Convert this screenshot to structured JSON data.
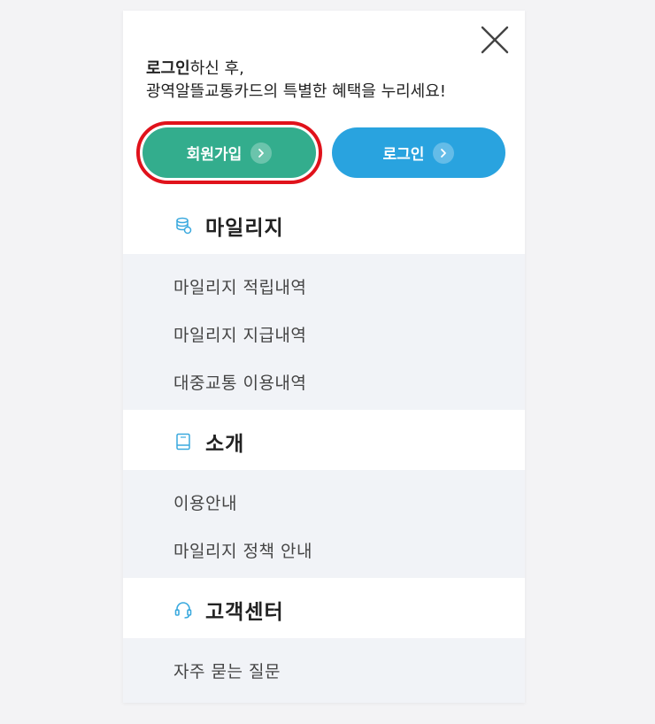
{
  "intro": {
    "line1_bold": "로그인",
    "line1_rest": "하신 후,",
    "line2": "광역알뜰교통카드의 특별한 혜택을 누리세요!"
  },
  "buttons": {
    "join": "회원가입",
    "login": "로그인"
  },
  "sections": [
    {
      "title": "마일리지",
      "icon": "coins-icon",
      "items": [
        "마일리지 적립내역",
        "마일리지 지급내역",
        "대중교통 이용내역"
      ]
    },
    {
      "title": "소개",
      "icon": "book-icon",
      "items": [
        "이용안내",
        "마일리지 정책 안내"
      ]
    },
    {
      "title": "고객센터",
      "icon": "headset-icon",
      "items": [
        "자주 묻는 질문"
      ]
    }
  ],
  "colors": {
    "join_button": "#33ad8d",
    "login_button": "#29a3df",
    "highlight": "#e0121b",
    "section_bg": "#f1f3f7",
    "icon_accent": "#3aa9de"
  }
}
